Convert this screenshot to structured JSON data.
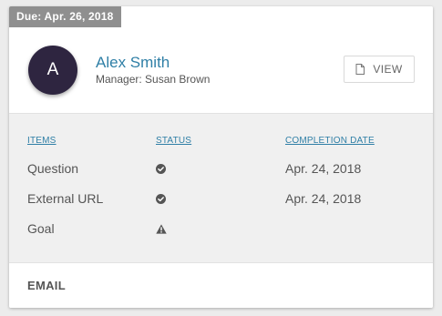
{
  "due_label": "Due: Apr. 26, 2018",
  "person": {
    "initial": "A",
    "name": "Alex Smith",
    "manager": "Manager: Susan Brown"
  },
  "view_button_label": "VIEW",
  "columns": {
    "items": "ITEMS",
    "status": "STATUS",
    "completion_date": "COMPLETION DATE"
  },
  "rows": [
    {
      "item": "Question",
      "status_icon": "check-circle-icon",
      "completion_date": "Apr. 24, 2018"
    },
    {
      "item": "External URL",
      "status_icon": "check-circle-icon",
      "completion_date": "Apr. 24, 2018"
    },
    {
      "item": "Goal",
      "status_icon": "warning-triangle-icon",
      "completion_date": ""
    }
  ],
  "footer": {
    "email_label": "EMAIL"
  },
  "colors": {
    "accent": "#2f7fa6",
    "avatar_bg": "#2e2540",
    "badge_bg": "#8f8f8f",
    "panel_bg": "#f0f0f0"
  }
}
